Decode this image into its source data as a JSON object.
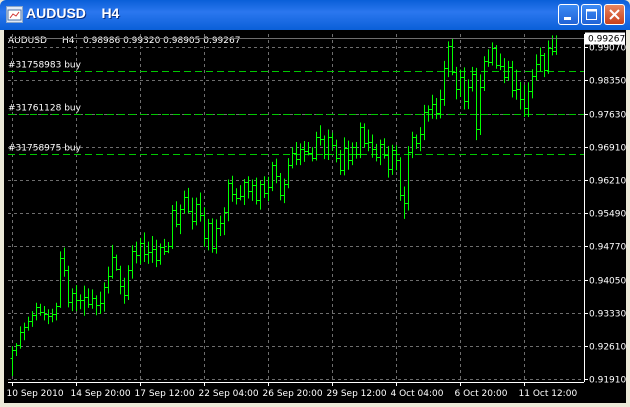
{
  "window": {
    "title": "AUDUSD    H4"
  },
  "chart_data": {
    "type": "ohlc",
    "symbol": "AUDUSD",
    "timeframe": "H4",
    "header": {
      "symbol": "AUDUSD",
      "timeframe": "H4",
      "ohlc": "0.98986 0.99320 0.98905 0.99267"
    },
    "price_labels": [
      "0.99070",
      "0.98350",
      "0.97630",
      "0.96910",
      "0.96210",
      "0.95490",
      "0.94770",
      "0.94050",
      "0.93330",
      "0.92610",
      "0.91910"
    ],
    "y_ticks": [
      0.9907,
      0.9835,
      0.9763,
      0.9691,
      0.9621,
      0.9549,
      0.9477,
      0.9405,
      0.9333,
      0.9261,
      0.9191
    ],
    "ylim": [
      0.9184,
      0.9935
    ],
    "current_price": {
      "label": "0.99267",
      "value": 0.99267
    },
    "x_labels": [
      "10 Sep 2010",
      "14 Sep 20:00",
      "17 Sep 12:00",
      "22 Sep 04:00",
      "26 Sep 20:00",
      "29 Sep 12:00",
      "4 Oct 04:00",
      "6 Oct 20:00",
      "11 Oct 12:00"
    ],
    "x_label_bars": [
      0,
      16,
      32,
      48,
      64,
      80,
      96,
      112,
      128
    ],
    "orders": [
      {
        "label": "#31758983 buy",
        "price": 0.9855
      },
      {
        "label": "#31761128 buy",
        "price": 0.9763
      },
      {
        "label": "#31758975 buy",
        "price": 0.9675
      }
    ],
    "bars": [
      [
        0.9236,
        0.9261,
        0.9197,
        0.9252
      ],
      [
        0.9252,
        0.9268,
        0.924,
        0.9264
      ],
      [
        0.9264,
        0.9304,
        0.9256,
        0.9291
      ],
      [
        0.9291,
        0.9312,
        0.9274,
        0.9302
      ],
      [
        0.9302,
        0.9325,
        0.9295,
        0.9316
      ],
      [
        0.9316,
        0.9337,
        0.9303,
        0.9328
      ],
      [
        0.9328,
        0.9355,
        0.9317,
        0.9345
      ],
      [
        0.9345,
        0.9353,
        0.9327,
        0.9336
      ],
      [
        0.9336,
        0.9348,
        0.9317,
        0.9331
      ],
      [
        0.9331,
        0.9341,
        0.9309,
        0.9326
      ],
      [
        0.9326,
        0.9342,
        0.9313,
        0.9331
      ],
      [
        0.9331,
        0.9355,
        0.9317,
        0.9348
      ],
      [
        0.9348,
        0.9466,
        0.9344,
        0.9452
      ],
      [
        0.9452,
        0.9474,
        0.9411,
        0.9426
      ],
      [
        0.9426,
        0.9435,
        0.9345,
        0.9357
      ],
      [
        0.9357,
        0.9386,
        0.9337,
        0.9377
      ],
      [
        0.9377,
        0.9393,
        0.9337,
        0.9362
      ],
      [
        0.9362,
        0.9373,
        0.9341,
        0.936
      ],
      [
        0.936,
        0.9392,
        0.9327,
        0.9368
      ],
      [
        0.9368,
        0.9386,
        0.9344,
        0.9352
      ],
      [
        0.9352,
        0.9384,
        0.9342,
        0.9366
      ],
      [
        0.9366,
        0.9371,
        0.9328,
        0.9351
      ],
      [
        0.9351,
        0.9379,
        0.9331,
        0.9355
      ],
      [
        0.9355,
        0.9399,
        0.9336,
        0.939
      ],
      [
        0.939,
        0.9433,
        0.9375,
        0.9412
      ],
      [
        0.9412,
        0.948,
        0.9407,
        0.9454
      ],
      [
        0.9454,
        0.9459,
        0.9424,
        0.9428
      ],
      [
        0.9428,
        0.9435,
        0.9373,
        0.9391
      ],
      [
        0.9391,
        0.9409,
        0.9353,
        0.9372
      ],
      [
        0.9372,
        0.9436,
        0.9361,
        0.9425
      ],
      [
        0.9425,
        0.9479,
        0.9407,
        0.9466
      ],
      [
        0.9466,
        0.9487,
        0.944,
        0.9457
      ],
      [
        0.9457,
        0.9495,
        0.9438,
        0.9484
      ],
      [
        0.9484,
        0.9507,
        0.9443,
        0.946
      ],
      [
        0.946,
        0.9487,
        0.9439,
        0.9465
      ],
      [
        0.9465,
        0.9499,
        0.9441,
        0.9471
      ],
      [
        0.9471,
        0.9491,
        0.9432,
        0.9447
      ],
      [
        0.9447,
        0.9483,
        0.9437,
        0.9476
      ],
      [
        0.9476,
        0.9493,
        0.9458,
        0.9466
      ],
      [
        0.9466,
        0.9486,
        0.9462,
        0.9478
      ],
      [
        0.9478,
        0.9566,
        0.9471,
        0.9555
      ],
      [
        0.9555,
        0.9574,
        0.9518,
        0.9524
      ],
      [
        0.9524,
        0.9567,
        0.9503,
        0.9558
      ],
      [
        0.9558,
        0.9597,
        0.9547,
        0.9583
      ],
      [
        0.9583,
        0.9603,
        0.9548,
        0.9554
      ],
      [
        0.9554,
        0.9582,
        0.9513,
        0.9531
      ],
      [
        0.9531,
        0.9582,
        0.9522,
        0.9568
      ],
      [
        0.9568,
        0.9593,
        0.953,
        0.9544
      ],
      [
        0.9544,
        0.9561,
        0.9476,
        0.9495
      ],
      [
        0.9495,
        0.9536,
        0.9468,
        0.9528
      ],
      [
        0.9528,
        0.9537,
        0.9463,
        0.9474
      ],
      [
        0.9474,
        0.9535,
        0.9461,
        0.9517
      ],
      [
        0.9517,
        0.9543,
        0.9499,
        0.9527
      ],
      [
        0.9527,
        0.9561,
        0.9501,
        0.955
      ],
      [
        0.955,
        0.9621,
        0.9531,
        0.9614
      ],
      [
        0.9614,
        0.9629,
        0.9573,
        0.959
      ],
      [
        0.959,
        0.9602,
        0.9567,
        0.9582
      ],
      [
        0.9582,
        0.9609,
        0.9576,
        0.9585
      ],
      [
        0.9585,
        0.9622,
        0.9566,
        0.9616
      ],
      [
        0.9616,
        0.9628,
        0.958,
        0.9596
      ],
      [
        0.9596,
        0.9621,
        0.9575,
        0.961
      ],
      [
        0.961,
        0.9625,
        0.9567,
        0.9577
      ],
      [
        0.9577,
        0.9619,
        0.9556,
        0.9612
      ],
      [
        0.9612,
        0.9628,
        0.9581,
        0.9592
      ],
      [
        0.9592,
        0.9627,
        0.9574,
        0.9605
      ],
      [
        0.9605,
        0.9659,
        0.9596,
        0.9653
      ],
      [
        0.9653,
        0.9666,
        0.9613,
        0.9628
      ],
      [
        0.9628,
        0.9635,
        0.9576,
        0.9587
      ],
      [
        0.9587,
        0.9623,
        0.957,
        0.9611
      ],
      [
        0.9611,
        0.9667,
        0.9602,
        0.9652
      ],
      [
        0.9652,
        0.9691,
        0.9645,
        0.9678
      ],
      [
        0.9678,
        0.9702,
        0.9652,
        0.9666
      ],
      [
        0.9666,
        0.9699,
        0.9652,
        0.9686
      ],
      [
        0.9686,
        0.9704,
        0.9659,
        0.9683
      ],
      [
        0.9683,
        0.9702,
        0.9673,
        0.9679
      ],
      [
        0.9679,
        0.9691,
        0.966,
        0.9667
      ],
      [
        0.9667,
        0.9724,
        0.9662,
        0.9712
      ],
      [
        0.9712,
        0.9738,
        0.9694,
        0.9709
      ],
      [
        0.9709,
        0.9716,
        0.9665,
        0.9677
      ],
      [
        0.9677,
        0.9729,
        0.9663,
        0.9713
      ],
      [
        0.9713,
        0.9722,
        0.9683,
        0.9696
      ],
      [
        0.9696,
        0.9707,
        0.9658,
        0.9667
      ],
      [
        0.9667,
        0.9685,
        0.9631,
        0.9641
      ],
      [
        0.9641,
        0.9712,
        0.963,
        0.969
      ],
      [
        0.969,
        0.9705,
        0.9642,
        0.9663
      ],
      [
        0.9663,
        0.9701,
        0.9652,
        0.9692
      ],
      [
        0.9692,
        0.9702,
        0.9666,
        0.9676
      ],
      [
        0.9676,
        0.9744,
        0.9667,
        0.9735
      ],
      [
        0.9735,
        0.9742,
        0.9689,
        0.9699
      ],
      [
        0.9699,
        0.9729,
        0.9682,
        0.9703
      ],
      [
        0.9703,
        0.9718,
        0.9668,
        0.9686
      ],
      [
        0.9686,
        0.9698,
        0.966,
        0.967
      ],
      [
        0.967,
        0.9707,
        0.9652,
        0.9697
      ],
      [
        0.9697,
        0.971,
        0.9666,
        0.9674
      ],
      [
        0.9674,
        0.9693,
        0.9625,
        0.9643
      ],
      [
        0.9643,
        0.9696,
        0.9631,
        0.9684
      ],
      [
        0.9684,
        0.9695,
        0.9641,
        0.9664
      ],
      [
        0.9664,
        0.9669,
        0.9575,
        0.9587
      ],
      [
        0.9587,
        0.9606,
        0.9536,
        0.9571
      ],
      [
        0.9571,
        0.9693,
        0.9554,
        0.9681
      ],
      [
        0.9681,
        0.9724,
        0.9667,
        0.9713
      ],
      [
        0.9713,
        0.9718,
        0.9687,
        0.9699
      ],
      [
        0.9699,
        0.9734,
        0.9682,
        0.972
      ],
      [
        0.972,
        0.9782,
        0.9706,
        0.9767
      ],
      [
        0.9767,
        0.9781,
        0.9746,
        0.9773
      ],
      [
        0.9773,
        0.9804,
        0.9752,
        0.9783
      ],
      [
        0.9783,
        0.9797,
        0.9751,
        0.9765
      ],
      [
        0.9765,
        0.9815,
        0.9753,
        0.9794
      ],
      [
        0.9794,
        0.9877,
        0.978,
        0.9862
      ],
      [
        0.9862,
        0.9919,
        0.9842,
        0.991
      ],
      [
        0.991,
        0.9926,
        0.9846,
        0.9852
      ],
      [
        0.9852,
        0.9864,
        0.9794,
        0.9817
      ],
      [
        0.9817,
        0.9858,
        0.9799,
        0.9842
      ],
      [
        0.9842,
        0.9863,
        0.9772,
        0.979
      ],
      [
        0.979,
        0.9837,
        0.9773,
        0.982
      ],
      [
        0.982,
        0.9864,
        0.9811,
        0.9848
      ],
      [
        0.9848,
        0.9862,
        0.9706,
        0.9729
      ],
      [
        0.9729,
        0.9848,
        0.9717,
        0.9821
      ],
      [
        0.9821,
        0.9887,
        0.9812,
        0.9877
      ],
      [
        0.9877,
        0.9902,
        0.9864,
        0.9875
      ],
      [
        0.9875,
        0.9917,
        0.9867,
        0.9904
      ],
      [
        0.9904,
        0.9911,
        0.986,
        0.9869
      ],
      [
        0.9869,
        0.9893,
        0.9857,
        0.9866
      ],
      [
        0.9866,
        0.9883,
        0.9829,
        0.9843
      ],
      [
        0.9843,
        0.9877,
        0.9834,
        0.9863
      ],
      [
        0.9863,
        0.9877,
        0.9798,
        0.9815
      ],
      [
        0.9815,
        0.9858,
        0.9793,
        0.9817
      ],
      [
        0.9817,
        0.9832,
        0.9772,
        0.9795
      ],
      [
        0.9795,
        0.9825,
        0.9756,
        0.9775
      ],
      [
        0.9775,
        0.9831,
        0.9756,
        0.9812
      ],
      [
        0.9812,
        0.9859,
        0.9796,
        0.9845
      ],
      [
        0.9845,
        0.9891,
        0.9835,
        0.9871
      ],
      [
        0.9871,
        0.9906,
        0.9854,
        0.989
      ],
      [
        0.989,
        0.9894,
        0.9842,
        0.9858
      ],
      [
        0.9858,
        0.9921,
        0.9849,
        0.9905
      ],
      [
        0.9905,
        0.9932,
        0.9889,
        0.9899
      ],
      [
        0.9899,
        0.9932,
        0.989,
        0.9927
      ]
    ]
  },
  "colors": {
    "bar": "#00ff00",
    "grid": "#6e6e6e",
    "order_line": "#00c800",
    "axis": "#ffffff",
    "text": "#ffffff",
    "chart_bg": "#000000",
    "title_bar": "#0a5fd8",
    "price_tag_bg": "#ffffff",
    "price_tag_text": "#000000"
  }
}
